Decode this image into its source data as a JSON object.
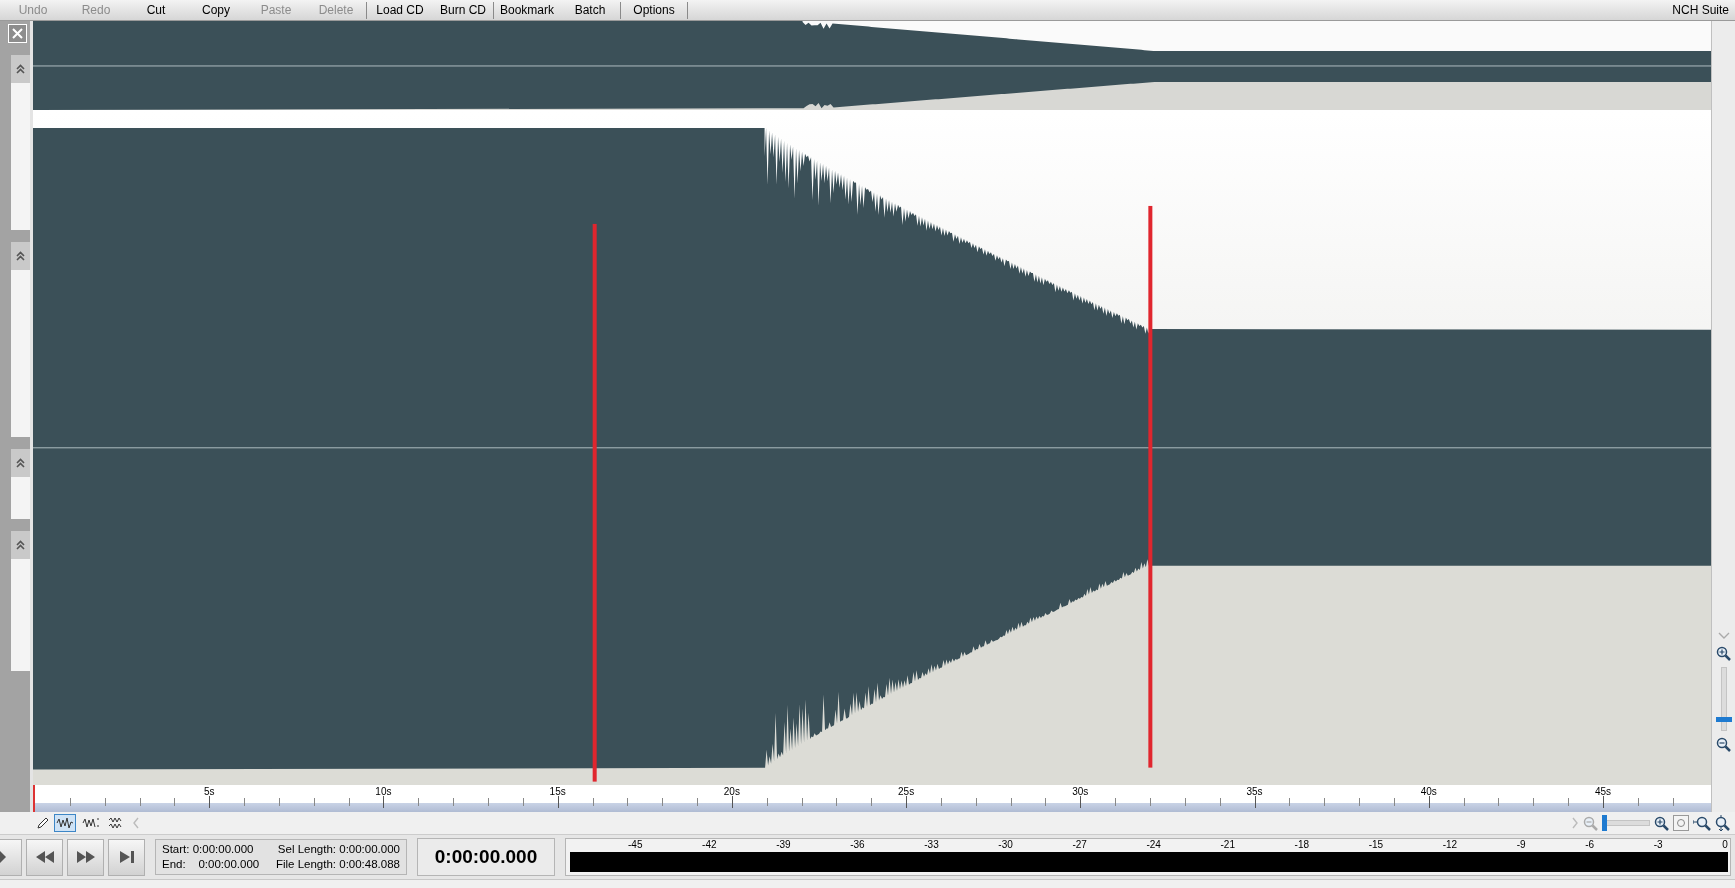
{
  "toolbar": {
    "groups": [
      [
        {
          "label": "Undo",
          "disabled": true
        },
        {
          "label": "Redo",
          "disabled": true
        },
        {
          "label": "Cut",
          "disabled": false
        },
        {
          "label": "Copy",
          "disabled": false
        },
        {
          "label": "Paste",
          "disabled": true
        },
        {
          "label": "Delete",
          "disabled": true
        }
      ],
      [
        {
          "label": "Load CD",
          "disabled": false
        },
        {
          "label": "Burn CD",
          "disabled": false
        }
      ],
      [
        {
          "label": "Bookmark",
          "disabled": false
        },
        {
          "label": "Batch",
          "disabled": false
        }
      ],
      [
        {
          "label": "Options",
          "disabled": false
        }
      ]
    ],
    "suite_label": "NCH Suite"
  },
  "timeline": {
    "ticks": [
      "5s",
      "10s",
      "15s",
      "20s",
      "25s",
      "30s",
      "35s",
      "40s",
      "45s"
    ]
  },
  "view_modes": [
    {
      "kind": "combined",
      "selected": true
    },
    {
      "kind": "split",
      "selected": false
    },
    {
      "kind": "stacked",
      "selected": false
    }
  ],
  "horizontal_zoom": {
    "level": 0.0
  },
  "vertical_zoom": {
    "level": 0.15
  },
  "position": {
    "start_label": "Start:",
    "start": "0:00:00.000",
    "end_label": "End:",
    "end": "0:00:00.000",
    "sel_length_label": "Sel Length:",
    "sel_length": "0:00:00.000",
    "file_length_label": "File Length:",
    "file_length": "0:00:48.088"
  },
  "time_display": "0:00:00.000",
  "meter": {
    "scale": [
      "-45",
      "-42",
      "-39",
      "-36",
      "-33",
      "-30",
      "-27",
      "-24",
      "-21",
      "-18",
      "-15",
      "-12",
      "-9",
      "-6",
      "-3",
      "0"
    ]
  }
}
